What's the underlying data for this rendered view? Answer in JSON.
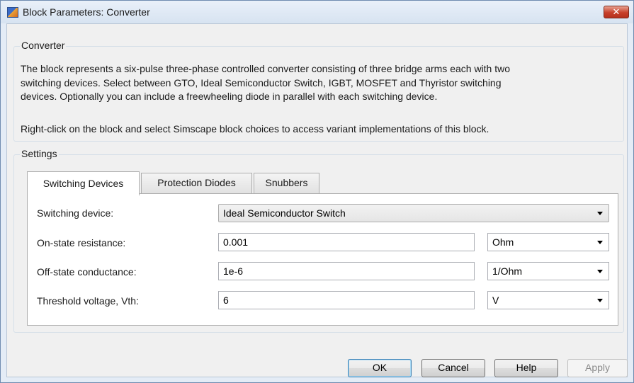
{
  "window": {
    "title": "Block Parameters: Converter",
    "close_label": "✕"
  },
  "converter_group": {
    "label": "Converter",
    "description_lines": [
      "The block represents a six-pulse three-phase controlled converter consisting of three bridge arms each with two",
      "switching devices. Select between GTO, Ideal Semiconductor Switch, IGBT, MOSFET and Thyristor switching",
      "devices. Optionally you can include a freewheeling diode in parallel with each switching device."
    ],
    "variant_note": "Right-click on the block and select Simscape block choices to access variant implementations of this block."
  },
  "settings_group": {
    "label": "Settings"
  },
  "tabs": [
    {
      "label": "Switching Devices",
      "active": true
    },
    {
      "label": "Protection Diodes",
      "active": false
    },
    {
      "label": "Snubbers",
      "active": false
    }
  ],
  "params": {
    "switching_device": {
      "label": "Switching device:",
      "value": "Ideal Semiconductor Switch"
    },
    "on_state_resistance": {
      "label": "On-state resistance:",
      "value": "0.001",
      "unit": "Ohm"
    },
    "off_state_conductance": {
      "label": "Off-state conductance:",
      "value": "1e-6",
      "unit": "1/Ohm"
    },
    "threshold_voltage": {
      "label": "Threshold voltage, Vth:",
      "value": "6",
      "unit": "V"
    }
  },
  "buttons": {
    "ok": "OK",
    "cancel": "Cancel",
    "help": "Help",
    "apply": "Apply"
  },
  "icons": {
    "app": "simulink-block-icon",
    "close": "close-icon",
    "dropdown": "chevron-down-icon"
  },
  "colors": {
    "title_bar": "#d7e3f1",
    "close_button": "#c7402a",
    "dialog_background": "#f0f0f0",
    "default_button_border": "#3c7fb1"
  }
}
